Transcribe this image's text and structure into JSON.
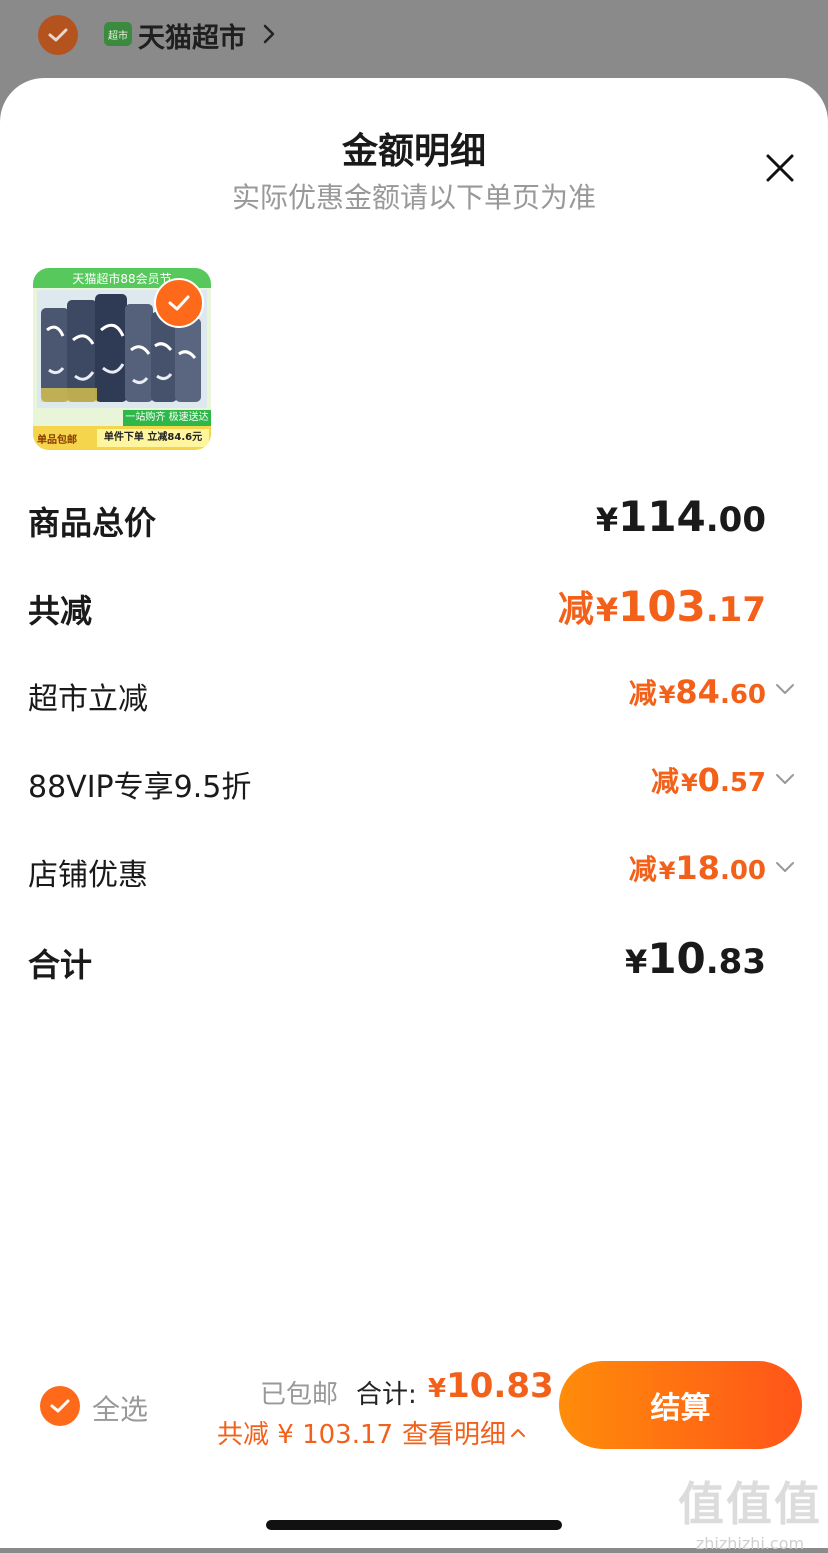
{
  "header": {
    "store_name": "天猫超市",
    "store_logo_text": "超市"
  },
  "sheet": {
    "title": "金额明细",
    "subtitle": "实际优惠金额请以下单页为准"
  },
  "product": {
    "banner": "天猫超市88会员节",
    "tag_green": "一站购齐 极速送达",
    "tag_left": "单品包邮",
    "tag_right": "单件下单 立减84.6元"
  },
  "rows": {
    "subtotal": {
      "label": "商品总价",
      "currency": "¥",
      "int": "114",
      "dec": ".00"
    },
    "discount_total": {
      "label": "共减",
      "prefix": "减",
      "currency": "¥",
      "int": "103",
      "dec": ".17"
    },
    "supermarket": {
      "label": "超市立减",
      "prefix": "减",
      "currency": "¥",
      "int": "84",
      "dec": ".60"
    },
    "vip": {
      "label": "88VIP专享9.5折",
      "prefix": "减",
      "currency": "¥",
      "int": "0",
      "dec": ".57"
    },
    "store": {
      "label": "店铺优惠",
      "prefix": "减",
      "currency": "¥",
      "int": "18",
      "dec": ".00"
    },
    "total": {
      "label": "合计",
      "currency": "¥",
      "int": "10",
      "dec": ".83"
    }
  },
  "footer": {
    "select_all": "全选",
    "shipping": "已包邮",
    "total_label": "合计:",
    "total_currency": "¥",
    "total_value": "10.83",
    "saved_text": "共减 ¥ 103.17",
    "detail_link": "查看明细",
    "checkout": "结算"
  },
  "watermark": {
    "big": "值值值",
    "small": "zhizhizhi.com"
  },
  "colors": {
    "accent": "#f2601a",
    "button_start": "#ff8c0a",
    "button_end": "#ff5519",
    "brand_green": "#3a8a3f"
  },
  "icons": [
    "check-icon",
    "chevron-right-icon",
    "close-icon",
    "chevron-down-icon",
    "chevron-up-icon"
  ]
}
